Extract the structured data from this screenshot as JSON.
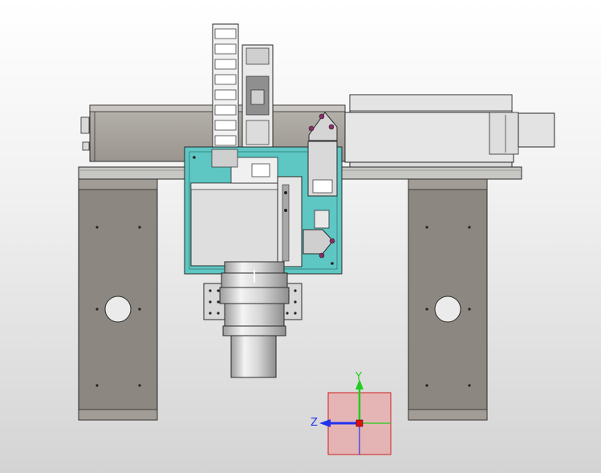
{
  "view": {
    "mode": "3d-model-front-view",
    "background": [
      "#ffffff",
      "#d4d4d4"
    ]
  },
  "colors": {
    "frame": "#c7c7c3",
    "leg": "#8c8780",
    "rail_body": "#a8a49e",
    "carriage_plate": "#5ec7c3",
    "housing": "#d9d9d9",
    "accent_magenta": "#8a2a6a",
    "outline": "#2a2a2a"
  },
  "triad": {
    "y_label": "Y",
    "z_label": "Z",
    "y_color": "#22cc22",
    "z_color": "#2233ee",
    "origin_color": "#dd1111",
    "plane_fill": "#e8a8a8",
    "plane_stroke": "#d02020"
  }
}
